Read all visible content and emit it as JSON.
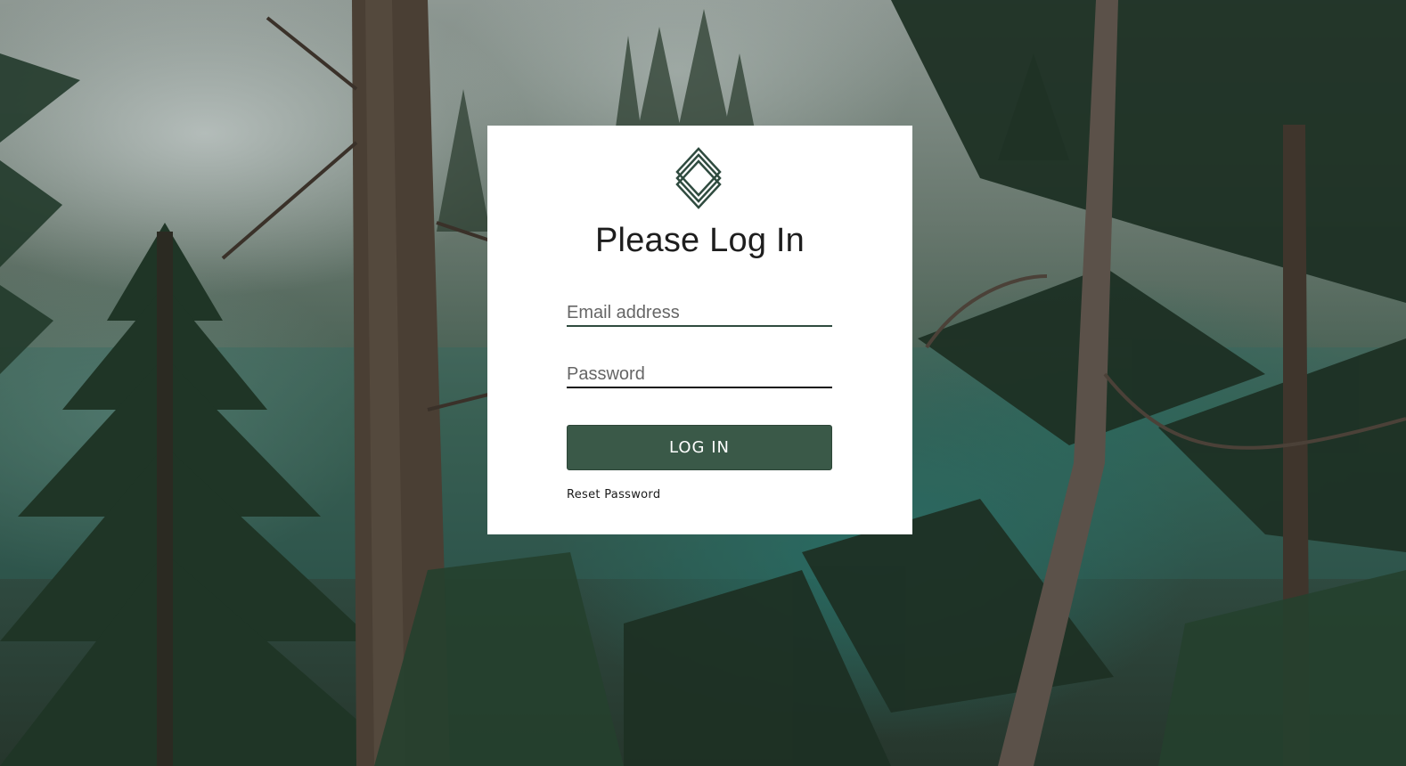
{
  "login": {
    "title": "Please Log In",
    "email_placeholder": "Email address",
    "password_placeholder": "Password",
    "submit_label": "LOG IN",
    "reset_label": "Reset Password"
  },
  "colors": {
    "brand_green": "#3a5948",
    "card_background": "#ffffff"
  },
  "icons": {
    "logo": "layered-diamond-logo"
  }
}
